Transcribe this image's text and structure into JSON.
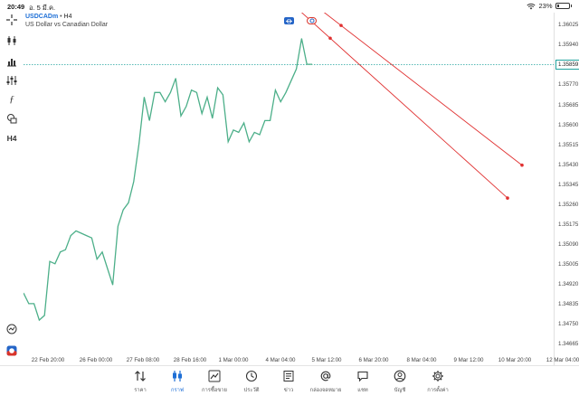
{
  "status_bar": {
    "time": "20:49",
    "date": "อ. 5 มี.ค.",
    "battery_text": "23%",
    "battery_level": 0.23,
    "icons": [
      "wifi-icon",
      "battery-icon"
    ]
  },
  "symbol": {
    "pair": "USDCADm",
    "separator": "•",
    "timeframe": "H4",
    "description": "US Dollar vs Canadian Dollar"
  },
  "left_toolbar": {
    "items": [
      {
        "name": "crosshair-icon",
        "label": ""
      },
      {
        "name": "candlestick-type-icon",
        "label": ""
      },
      {
        "name": "bar-chart-icon",
        "label": ""
      },
      {
        "name": "indicator-settings-icon",
        "label": ""
      },
      {
        "name": "function-icon",
        "label": ""
      },
      {
        "name": "objects-icon",
        "label": ""
      },
      {
        "name": "timeframe-button",
        "label": "H4"
      }
    ]
  },
  "price_axis": {
    "labels": [
      "1.36025",
      "1.35940",
      "1.35855",
      "1.35770",
      "1.35685",
      "1.35600",
      "1.35515",
      "1.35430",
      "1.35345",
      "1.35260",
      "1.35175",
      "1.35090",
      "1.35005",
      "1.34920",
      "1.34835",
      "1.34750",
      "1.34665"
    ],
    "current_price": "1.35859",
    "current_price_color": "#20a39e"
  },
  "time_axis": {
    "labels": [
      "22 Feb 20:00",
      "26 Feb 00:00",
      "27 Feb 08:00",
      "28 Feb 16:00",
      "1 Mar 00:00",
      "4 Mar 04:00",
      "5 Mar 12:00",
      "6 Mar 20:00",
      "8 Mar 04:00",
      "9 Mar 12:00",
      "10 Mar 20:00",
      "12 Mar 04:00"
    ]
  },
  "chart_data": {
    "type": "line",
    "series": [
      {
        "color": "#4caf89",
        "values": [
          1.34885,
          1.3484,
          1.3484,
          1.3477,
          1.3479,
          1.3502,
          1.3501,
          1.3506,
          1.3507,
          1.3513,
          1.3515,
          1.3514,
          1.3513,
          1.3512,
          1.3503,
          1.3506,
          1.3499,
          1.3492,
          1.3517,
          1.3524,
          1.3527,
          1.3536,
          1.3552,
          1.3572,
          1.3562,
          1.3574,
          1.3574,
          1.357,
          1.3574,
          1.358,
          1.3564,
          1.3568,
          1.3575,
          1.3574,
          1.3565,
          1.3572,
          1.3563,
          1.3576,
          1.3573,
          1.3553,
          1.3558,
          1.3557,
          1.3561,
          1.3553,
          1.3557,
          1.3556,
          1.3562,
          1.3562,
          1.3575,
          1.357,
          1.3574,
          1.3579,
          1.3584,
          1.3597,
          1.3586,
          1.3586
        ]
      }
    ],
    "trendlines": [
      {
        "color": "#e03030",
        "from_price": 1.366,
        "to_price": 1.3543,
        "handle_price": 1.35859
      },
      {
        "color": "#e03030",
        "from_price": 1.366,
        "to_price": 1.3529,
        "handle_price": 1.357
      }
    ],
    "ylim": [
      1.3462,
      1.3608
    ],
    "grid": false,
    "price_line": 1.35859
  },
  "bottom_nav": {
    "items": [
      {
        "name": "quotes",
        "label": "ราคา",
        "active": false
      },
      {
        "name": "chart",
        "label": "กราฟ",
        "active": true
      },
      {
        "name": "trade",
        "label": "การซื้อขาย",
        "active": false
      },
      {
        "name": "history",
        "label": "ประวัติ",
        "active": false
      },
      {
        "name": "news",
        "label": "ข่าว",
        "active": false
      },
      {
        "name": "mailbox",
        "label": "กล่องจดหมาย",
        "active": false
      },
      {
        "name": "chat",
        "label": "แชท",
        "active": false
      },
      {
        "name": "accounts",
        "label": "บัญชี",
        "active": false
      },
      {
        "name": "settings",
        "label": "การตั้งค่า",
        "active": false
      }
    ]
  }
}
